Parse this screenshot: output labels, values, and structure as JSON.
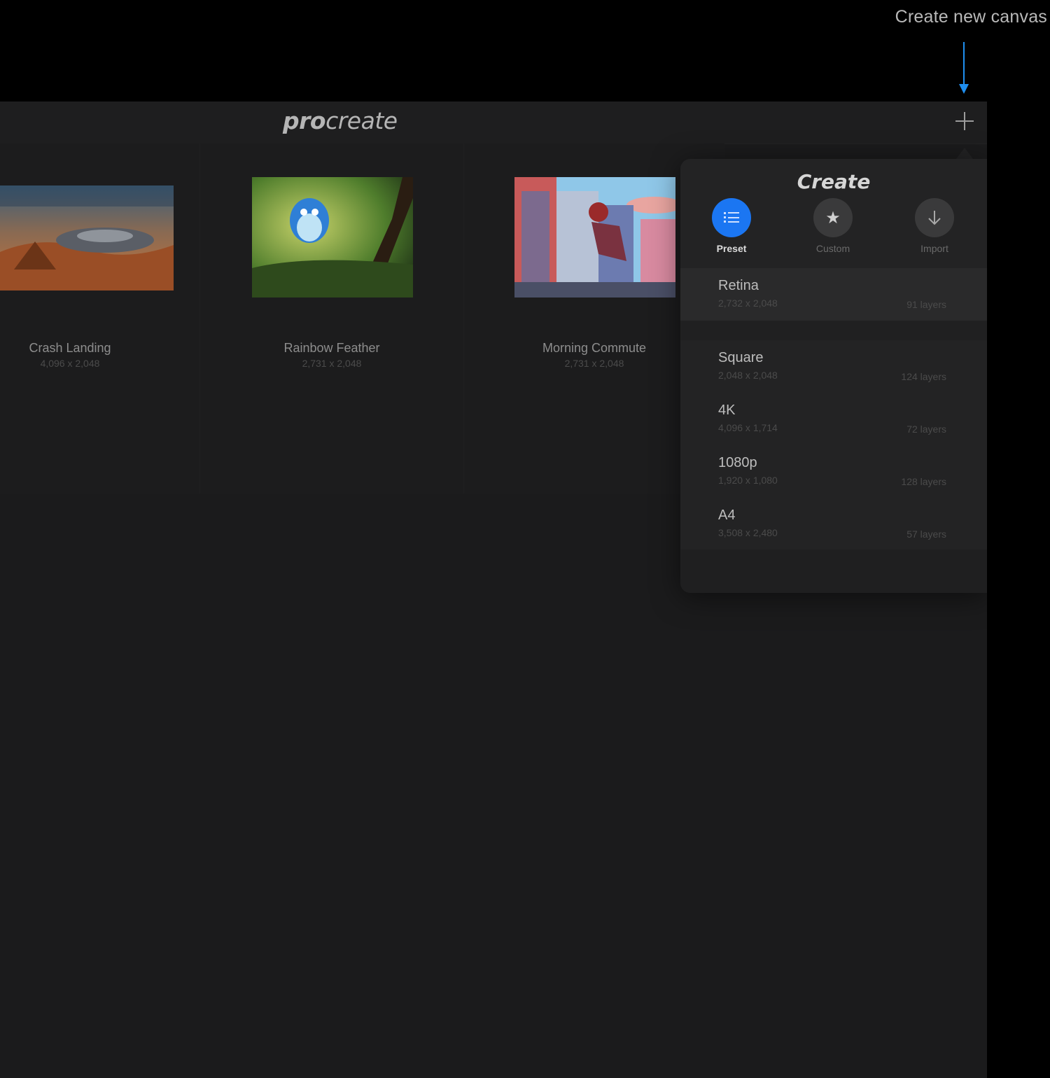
{
  "annotation": {
    "text": "Create new canvas",
    "arrow_color": "#1f8ff0"
  },
  "app": {
    "logo_bold": "pro",
    "logo_light": "create"
  },
  "gallery": {
    "cards": [
      {
        "title": "Crash Landing",
        "size": "4,096 x 2,048"
      },
      {
        "title": "Rainbow Feather",
        "size": "2,731 x 2,048"
      },
      {
        "title": "Morning Commute",
        "size": "2,731 x 2,048"
      }
    ]
  },
  "create_popover": {
    "title": "Create",
    "tabs": [
      {
        "label": "Preset",
        "icon": "list-icon",
        "active": true
      },
      {
        "label": "Custom",
        "icon": "star-icon",
        "active": false
      },
      {
        "label": "Import",
        "icon": "download-arrow-icon",
        "active": false
      }
    ],
    "presets": [
      {
        "name": "Retina",
        "dims": "2,732 x 2,048",
        "layers": "91 layers"
      },
      {
        "name": "Square",
        "dims": "2,048 x 2,048",
        "layers": "124 layers"
      },
      {
        "name": "4K",
        "dims": "4,096 x 1,714",
        "layers": "72 layers"
      },
      {
        "name": "1080p",
        "dims": "1,920 x 1,080",
        "layers": "128 layers"
      },
      {
        "name": "A4",
        "dims": "3,508 x 2,480",
        "layers": "57 layers"
      }
    ]
  },
  "colors": {
    "accent": "#1b76f2",
    "background": "#1b1b1c"
  }
}
